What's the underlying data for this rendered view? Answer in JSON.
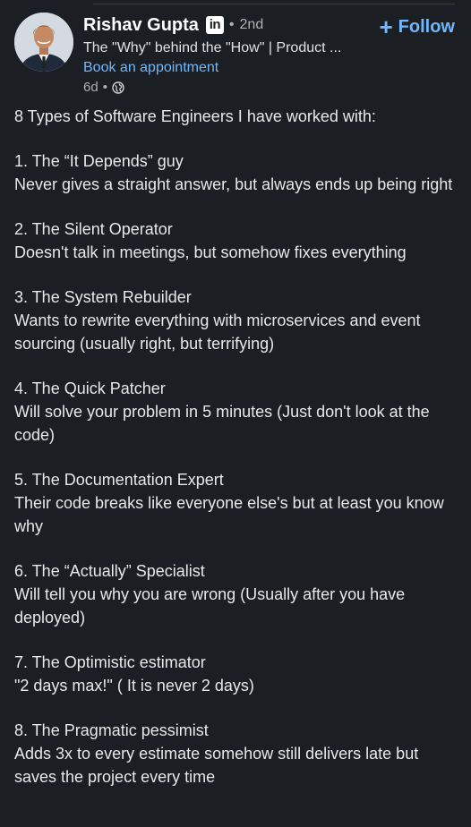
{
  "colors": {
    "background": "#1b1f23",
    "text": "#e8e8e8",
    "muted": "#b0b0b0",
    "link": "#71b7fb"
  },
  "author": {
    "name": "Rishav Gupta",
    "badge": "in",
    "degree": "2nd",
    "headline": "The \"Why\" behind the \"How\" | Product ...",
    "booking": "Book an appointment",
    "time": "6d",
    "visibility_icon": "globe-icon"
  },
  "follow": {
    "plus": "+",
    "label": "Follow"
  },
  "post": {
    "intro": "8 Types of Software Engineers I have worked with:",
    "items": [
      {
        "title": "1. The “It Depends” guy",
        "description": "Never gives a straight answer, but always ends up being right"
      },
      {
        "title": "2. The Silent Operator",
        "description": "Doesn't talk in meetings, but somehow fixes everything"
      },
      {
        "title": "3. The System Rebuilder",
        "description": "Wants to rewrite everything with microservices and event sourcing (usually right, but terrifying)"
      },
      {
        "title": "4. The Quick Patcher",
        "description": "Will solve your problem in 5 minutes (Just don't look at the code)"
      },
      {
        "title": "5. The Documentation Expert",
        "description": "Their code breaks like everyone else's but at least you know why"
      },
      {
        "title": "6. The “Actually” Specialist",
        "description": "Will tell you why you are wrong (Usually after you have deployed)"
      },
      {
        "title": "7. The Optimistic estimator",
        "description": "\"2 days max!\" ( It is never 2 days)"
      },
      {
        "title": "8. The Pragmatic pessimist",
        "description": "Adds 3x to every estimate somehow still delivers late but saves the project every time"
      }
    ]
  }
}
